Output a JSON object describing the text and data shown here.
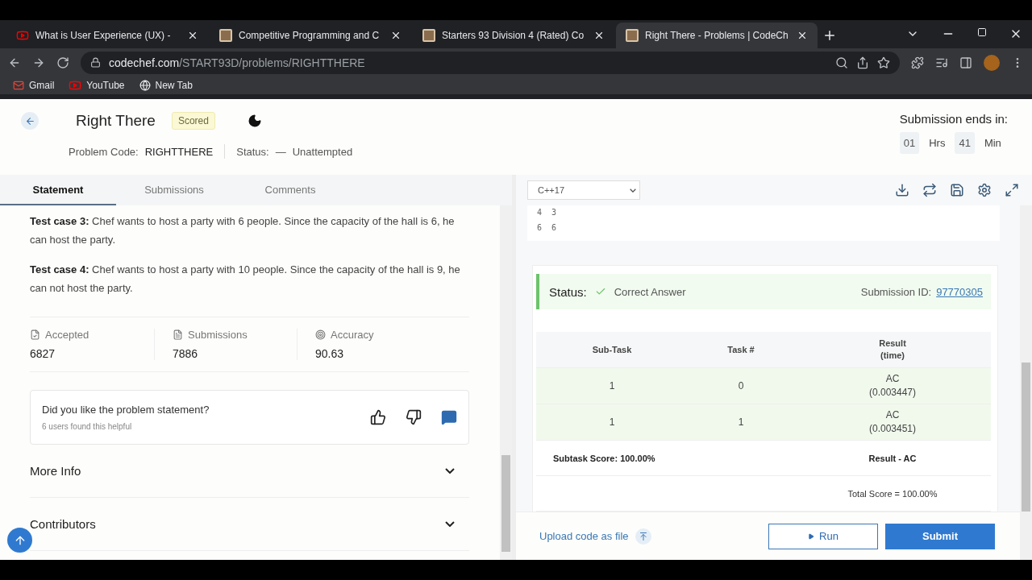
{
  "browser": {
    "tabs": [
      {
        "title": "What is User Experience (UX) -",
        "kind": "video",
        "selected": false
      },
      {
        "title": "Competitive Programming and C",
        "kind": "cc",
        "selected": false
      },
      {
        "title": "Starters 93 Division 4 (Rated) Co",
        "kind": "cc",
        "selected": false
      },
      {
        "title": "Right There - Problems | CodeCh",
        "kind": "cc",
        "selected": true
      }
    ],
    "url": {
      "domain": "codechef.com",
      "path": "/START93D/problems/RIGHTTHERE"
    },
    "bookmarks": [
      {
        "label": "Gmail",
        "kind": "mail"
      },
      {
        "label": "YouTube",
        "kind": "video"
      },
      {
        "label": "New Tab",
        "kind": "globe"
      }
    ]
  },
  "header": {
    "title": "Right There",
    "badge": "Scored",
    "code_label": "Problem Code:",
    "code": "RIGHTTHERE",
    "status_label": "Status:",
    "status_dash": "—",
    "status_value": "Unattempted",
    "timer": {
      "heading": "Submission ends in:",
      "hours": "01",
      "hours_unit": "Hrs",
      "minutes": "41",
      "minutes_unit": "Min"
    }
  },
  "left_tabs": [
    {
      "label": "Statement",
      "selected": true
    },
    {
      "label": "Submissions",
      "selected": false
    },
    {
      "label": "Comments",
      "selected": false
    }
  ],
  "statement": [
    "**Test case 3:** Chef wants to host a party with 6 people. Since the capacity of the hall is 6, he can host the party.",
    "**Test case 4:** Chef wants to host a party with 10 people. Since the capacity of the hall is 9, he can not host the party."
  ],
  "stats": [
    {
      "label": "Accepted",
      "value": "6827",
      "kind": "accepted"
    },
    {
      "label": "Submissions",
      "value": "7886",
      "kind": "file"
    },
    {
      "label": "Accuracy",
      "value": "90.63",
      "kind": "target"
    }
  ],
  "feedback": {
    "question": "Did you like the problem statement?",
    "helpful": "6 users found this helpful"
  },
  "sections": [
    {
      "label": "More Info"
    },
    {
      "label": "Contributors"
    }
  ],
  "editor": {
    "language": "C++17",
    "code_lines": [
      "4  3",
      "6  6"
    ]
  },
  "result": {
    "status_label": "Status:",
    "status_value": "Correct Answer",
    "id_label": "Submission ID:",
    "id": "97770305",
    "columns": [
      "Sub-Task",
      "Task #",
      "Result\n(time)"
    ],
    "rows": [
      [
        "1",
        "0",
        "AC\n(0.003447)"
      ],
      [
        "1",
        "1",
        "AC\n(0.003451)"
      ]
    ],
    "subtask_score": "Subtask Score: 100.00%",
    "result_summary": "Result - AC",
    "total_score": "Total Score = 100.00%"
  },
  "footer": {
    "upload": "Upload code as file",
    "run": "Run",
    "submit": "Submit"
  }
}
